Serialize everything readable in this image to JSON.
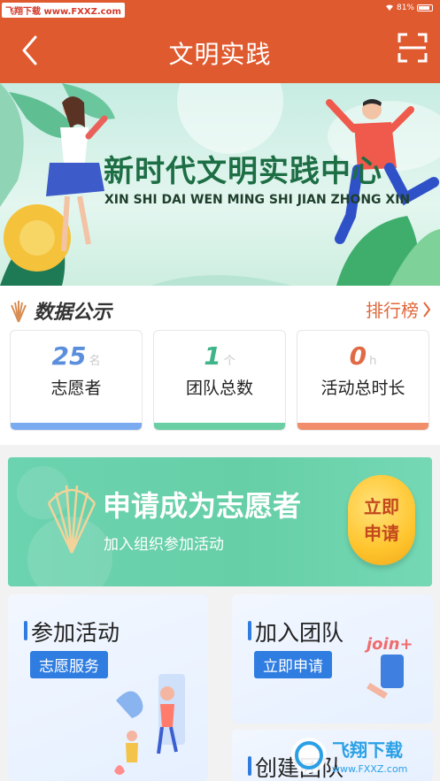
{
  "statusbar": {
    "watermark": "飞翔下载 www.FXXZ.com",
    "battery": "81%"
  },
  "navbar": {
    "title": "文明实践"
  },
  "banner": {
    "title": "新时代文明实践中心",
    "subtitle": "XIN SHI DAI WEN MING SHI JIAN ZHONG XIN"
  },
  "data_section": {
    "title": "数据公示",
    "rank_link": "排行榜",
    "stats": [
      {
        "value": "25",
        "unit": "名",
        "label": "志愿者",
        "color": "#5b8fdc",
        "bar": "#7aaaf0"
      },
      {
        "value": "1",
        "unit": "个",
        "label": "团队总数",
        "color": "#3fb48a",
        "bar": "#6bcfa6"
      },
      {
        "value": "0",
        "unit": "h",
        "label": "活动总时长",
        "color": "#e06a45",
        "bar": "#f28d6c"
      }
    ]
  },
  "apply": {
    "title": "申请成为志愿者",
    "subtitle": "加入组织参加活动",
    "button": "立即申请"
  },
  "tiles": {
    "activity": {
      "title": "参加活动",
      "badge": "志愿服务"
    },
    "team": {
      "title": "加入团队",
      "badge": "立即申请",
      "art_text": "join+"
    },
    "create": {
      "title": "创建团队"
    }
  },
  "watermark_logo": {
    "brand": "飞翔下载",
    "url": "www.FXXZ.com"
  },
  "colors": {
    "primary": "#e05a2f",
    "accent_blue": "#2f7de1",
    "green": "#66cfa7"
  }
}
